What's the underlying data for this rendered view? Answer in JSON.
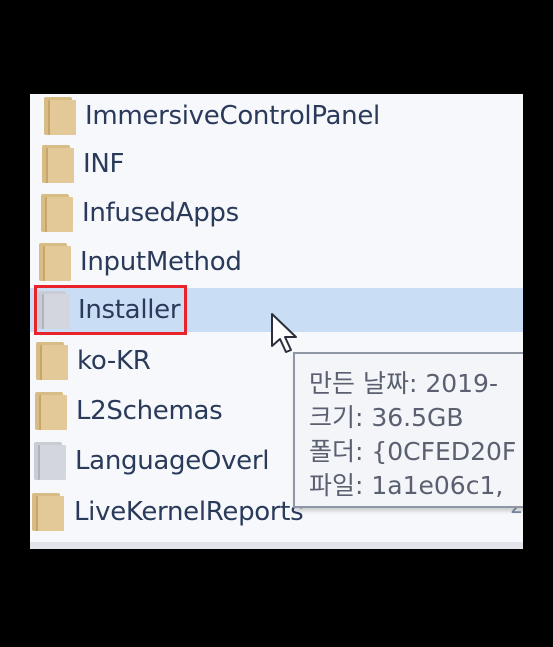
{
  "files": [
    {
      "name": "ImmersiveControlPanel",
      "icon": "folder-icon",
      "selected": false
    },
    {
      "name": "INF",
      "icon": "folder-icon",
      "selected": false
    },
    {
      "name": "InfusedApps",
      "icon": "folder-icon",
      "selected": false
    },
    {
      "name": "InputMethod",
      "icon": "folder-icon",
      "selected": false
    },
    {
      "name": "Installer",
      "icon": "folder-icon",
      "selected": true
    },
    {
      "name": "ko-KR",
      "icon": "folder-icon",
      "selected": false
    },
    {
      "name": "L2Schemas",
      "icon": "folder-icon",
      "selected": false
    },
    {
      "name": "LanguageOverl",
      "icon": "folder-icon",
      "selected": false
    },
    {
      "name": "LiveKernelReports",
      "icon": "folder-icon",
      "selected": false
    }
  ],
  "selected_row_edge_text": "2",
  "tooltip": {
    "created": "만든 날짜: 2019-",
    "size": "크기: 36.5GB",
    "folders": "폴더: {0CFED20F",
    "files": "파일: 1a1e06c1,"
  },
  "colors": {
    "highlight_box": "#e8232a",
    "selection": "#c9def4",
    "folder": "#e3c998"
  }
}
